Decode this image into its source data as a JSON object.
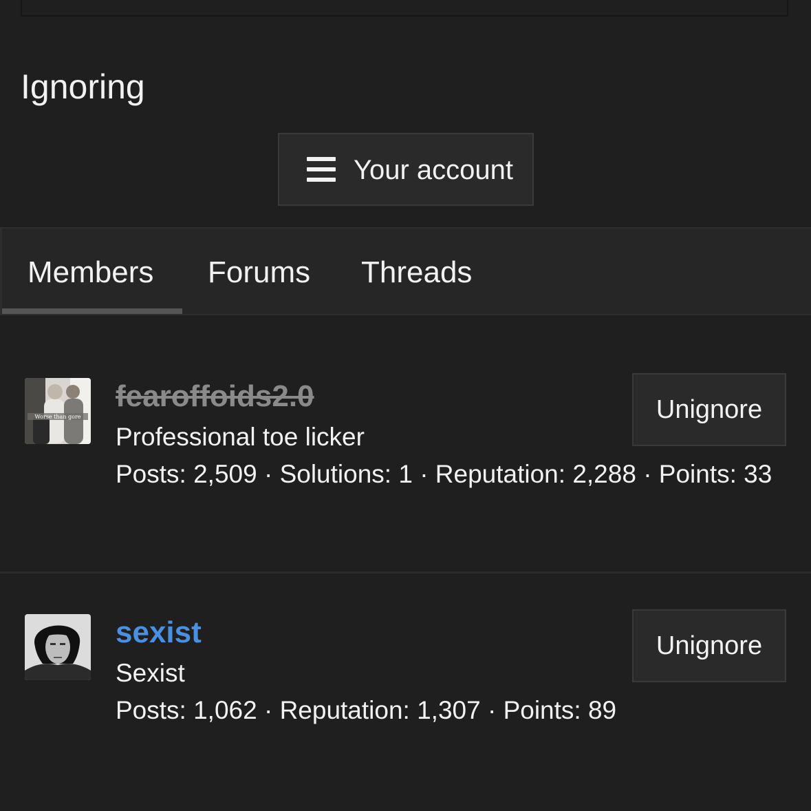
{
  "page": {
    "title": "Ignoring"
  },
  "account_menu": {
    "label": "Your account",
    "icon": "hamburger-menu-icon"
  },
  "tabs": [
    {
      "label": "Members",
      "active": true
    },
    {
      "label": "Forums",
      "active": false
    },
    {
      "label": "Threads",
      "active": false
    }
  ],
  "members": [
    {
      "username": "fearoffoids2.0",
      "username_style": "strikethrough-gray",
      "title": "Professional toe licker",
      "stats": "Posts: 2,509 · Solutions: 1 · Reputation: 2,288 · Points: 33",
      "action_label": "Unignore",
      "avatar_caption": "Worse than gore"
    },
    {
      "username": "sexist",
      "username_style": "link-blue",
      "title": "Sexist",
      "stats": "Posts: 1,062 · Reputation: 1,307 · Points: 89",
      "action_label": "Unignore"
    }
  ],
  "colors": {
    "background": "#1f1f1f",
    "tab_bar": "#262626",
    "button": "#2a2a2a",
    "link": "#4a90e2",
    "muted": "#8a8a8a"
  }
}
